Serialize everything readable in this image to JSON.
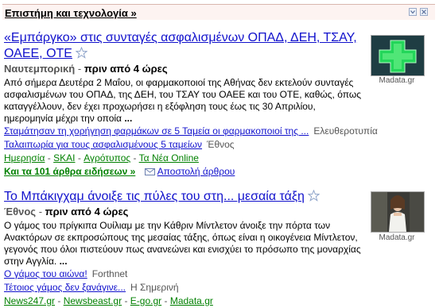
{
  "section": {
    "title": "Επιστήμη και τεχνολογία »"
  },
  "stories": [
    {
      "title": "«Εμπάργκο» στις συνταγές ασφαλισμένων ΟΠΑΔ, ΔΕΗ, ΤΣΑΥ, ΟΑΕΕ, ΟΤΕ",
      "source": "Ναυτεμπορική",
      "age": "πριν από 4 ώρες",
      "snippet": "Από σήμερα Δευτέρα 2 Μαΐου, οι φαρμακοποιοί της Αθήνας δεν εκτελούν συνταγές ασφαλισμένων του ΟΠΑΔ, της ΔΕΗ, του ΤΣΑΥ του ΟΑΕΕ και του ΟΤΕ, καθώς, όπως καταγγέλλουν, δεν έχει προχωρήσει η εξόφληση τους έως τις 30 Απριλίου, ημερομηνία μέχρι την οποία",
      "more": "...",
      "related": [
        {
          "title": "Σταμάτησαν τη χορήγηση φαρμάκων σε 5 Ταμεία οι φαρμακοποιοί της ...",
          "source": "Ελευθεροτυπία"
        },
        {
          "title": "Ταλαιπωρία για τους ασφαλισμένους 5 ταμείων",
          "source": "Έθνος"
        }
      ],
      "more_sources": [
        "Ημερησία",
        "SKAI",
        "Αγρότυπος",
        "Τα Νέα Online"
      ],
      "all_articles": "Και τα 101 άρθρα ειδήσεων »",
      "email": "Αποστολή άρθρου",
      "image_caption": "Madata.gr"
    },
    {
      "title": "Το Μπάκιγχαμ άνοιξε τις πύλες του στη... μεσαία τάξη",
      "source": "Έθνος",
      "age": "πριν από 4 ώρες",
      "snippet": "Ο γάμος του πρίγκιπα Ουίλιαμ με την Κάθριν Μίντλετον άνοιξε την πόρτα των Ανακτόρων σε εκπροσώπους της μεσαίας τάξης, όπως είναι η οικογένεια Μίντλετον, γεγονός που όλοι πιστεύουν πως ανανεώνει και ενισχύει το πρόσωπο της μοναρχίας στην Αγγλία.",
      "more": "...",
      "related": [
        {
          "title": "Ο γάμος του αιώνα!",
          "source": "Forthnet"
        },
        {
          "title": "Τέτοιος γάμος δεν ξανάγινε...",
          "source": "Η Σημερινή"
        }
      ],
      "more_sources": [
        "News247.gr",
        "Newsbeast.gr",
        "E-go.gr",
        "Madata.gr"
      ],
      "image_caption": "Madata.gr"
    }
  ],
  "colors": {
    "link": "#1111cc",
    "green_link": "#008000",
    "header_bg": "#fdf3f1"
  }
}
